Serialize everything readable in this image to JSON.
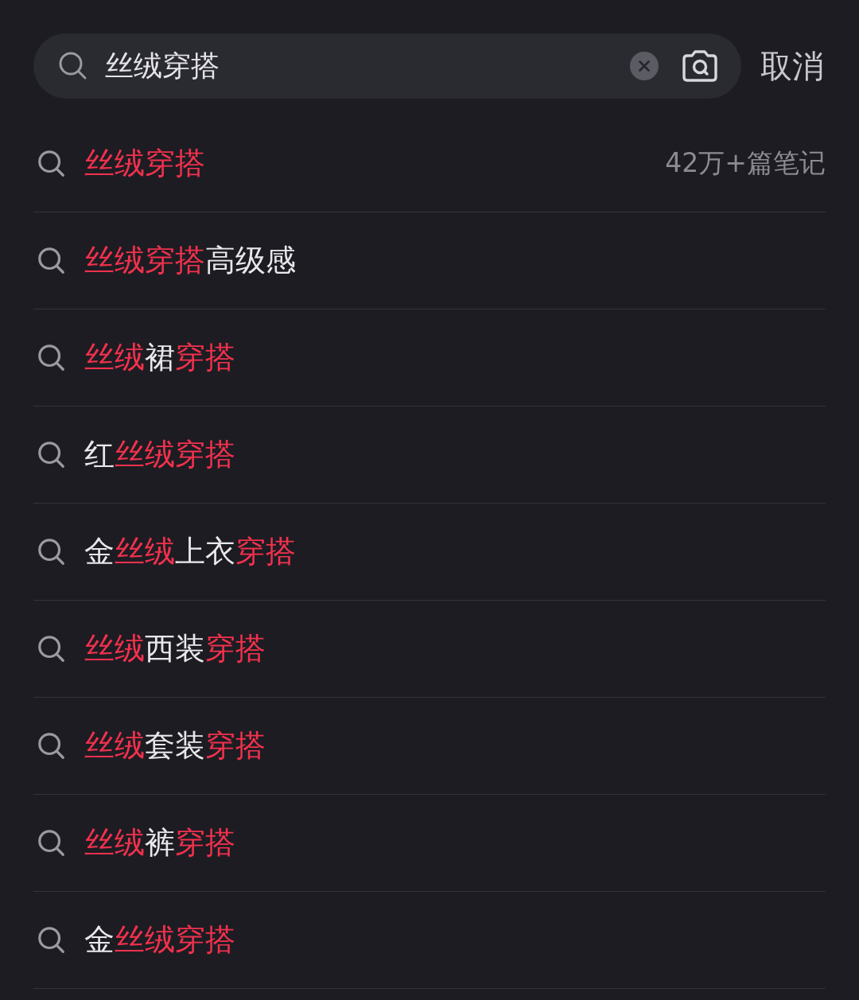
{
  "search": {
    "value": "丝绒穿搭",
    "cancel": "取消"
  },
  "suggestions": [
    {
      "segments": [
        {
          "text": "丝绒穿搭",
          "highlight": true
        }
      ],
      "count": "42万+篇笔记"
    },
    {
      "segments": [
        {
          "text": "丝绒穿搭",
          "highlight": true
        },
        {
          "text": "高级感",
          "highlight": false
        }
      ]
    },
    {
      "segments": [
        {
          "text": "丝绒",
          "highlight": true
        },
        {
          "text": "裙",
          "highlight": false
        },
        {
          "text": "穿搭",
          "highlight": true
        }
      ]
    },
    {
      "segments": [
        {
          "text": "红",
          "highlight": false
        },
        {
          "text": "丝绒穿搭",
          "highlight": true
        }
      ]
    },
    {
      "segments": [
        {
          "text": "金",
          "highlight": false
        },
        {
          "text": "丝绒",
          "highlight": true
        },
        {
          "text": "上衣",
          "highlight": false
        },
        {
          "text": "穿搭",
          "highlight": true
        }
      ]
    },
    {
      "segments": [
        {
          "text": "丝绒",
          "highlight": true
        },
        {
          "text": "西装",
          "highlight": false
        },
        {
          "text": "穿搭",
          "highlight": true
        }
      ]
    },
    {
      "segments": [
        {
          "text": "丝绒",
          "highlight": true
        },
        {
          "text": "套装",
          "highlight": false
        },
        {
          "text": "穿搭",
          "highlight": true
        }
      ]
    },
    {
      "segments": [
        {
          "text": "丝绒",
          "highlight": true
        },
        {
          "text": "裤",
          "highlight": false
        },
        {
          "text": "穿搭",
          "highlight": true
        }
      ]
    },
    {
      "segments": [
        {
          "text": "金",
          "highlight": false
        },
        {
          "text": "丝绒穿搭",
          "highlight": true
        }
      ]
    }
  ]
}
